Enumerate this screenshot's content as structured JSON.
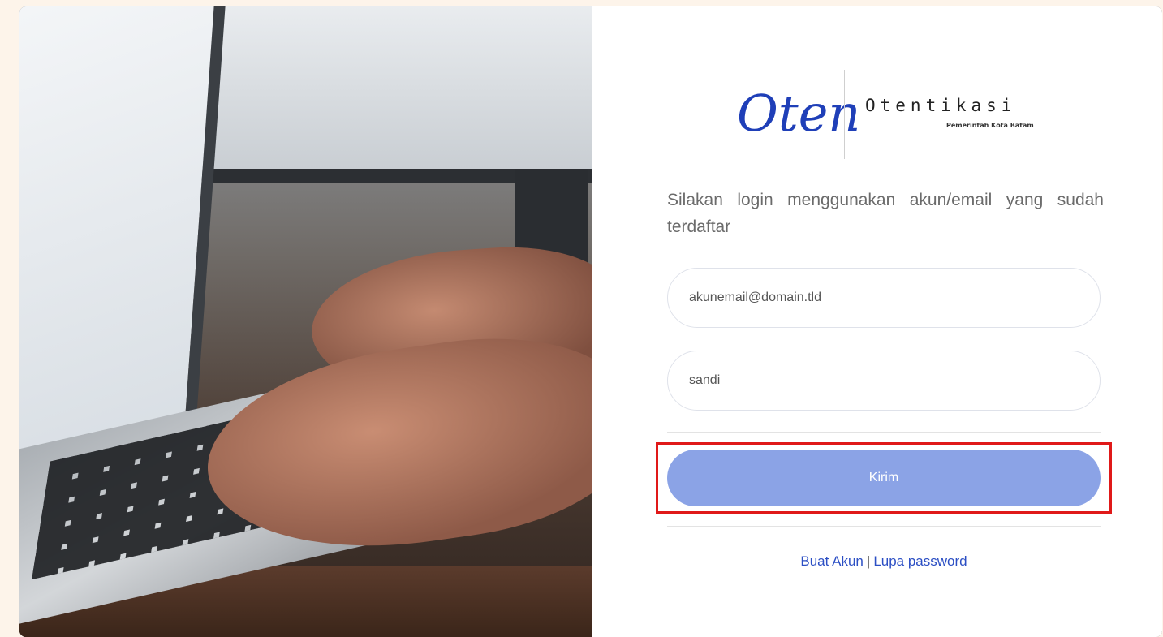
{
  "logo": {
    "script_text": "Oten",
    "wordmark": "Otentikasi",
    "subtitle": "Pemerintah Kota Batam",
    "brand_color": "#1f3fb8"
  },
  "intro_text": "Silakan login menggunakan akun/email yang sudah terdaftar",
  "form": {
    "email_placeholder": "akunemail@domain.tld",
    "password_placeholder": "sandi",
    "submit_label": "Kirim",
    "submit_color": "#8ba3e6"
  },
  "links": {
    "create_account": "Buat Akun",
    "separator": "|",
    "forgot_password": "Lupa password"
  },
  "annotation": {
    "highlight_color": "#e01919"
  }
}
